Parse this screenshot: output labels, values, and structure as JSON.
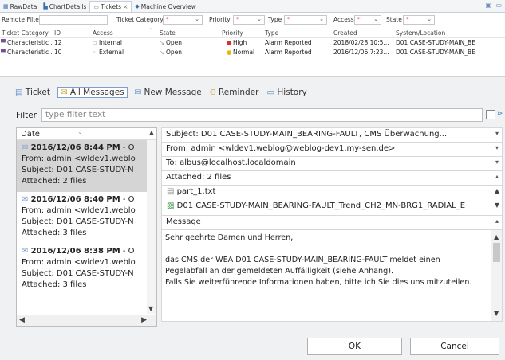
{
  "tabs": [
    {
      "label": "RawData",
      "icon": "table-icon"
    },
    {
      "label": "ChartDetails",
      "icon": "chart-icon"
    },
    {
      "label": "Tickets",
      "icon": "tickets-icon",
      "close": "×",
      "active": true
    },
    {
      "label": "Machine Overview",
      "icon": "machine-icon"
    }
  ],
  "filters": {
    "remote_filter_label": "Remote Filter",
    "ticket_category_label": "Ticket Category",
    "priority_label": "Priority",
    "type_label": "Type",
    "access_label": "Access",
    "state_label": "State",
    "dropdown_glyph": "*"
  },
  "table": {
    "columns": [
      "Ticket Category",
      "ID",
      "Access",
      "State",
      "Priority",
      "Type",
      "Created",
      "System/Location"
    ],
    "rows": [
      {
        "category": "Characteristic ...",
        "id": "12",
        "access": "Internal",
        "state": "Open",
        "priority": "High",
        "type": "Alarm Reported",
        "created": "2018/02/28 10:5...",
        "location": "D01 CASE-STUDY-MAIN_BE"
      },
      {
        "category": "Characteristic ...",
        "id": "10",
        "access": "External",
        "state": "Open",
        "priority": "Normal",
        "type": "Alarm Reported",
        "created": "2016/12/06 7:23...",
        "location": "D01 CASE-STUDY-MAIN_BE"
      }
    ]
  },
  "subtabs": [
    {
      "label": "Ticket",
      "icon": "ticket-icon"
    },
    {
      "label": "All Messages",
      "icon": "messages-icon",
      "active": true
    },
    {
      "label": "New Message",
      "icon": "new-message-icon"
    },
    {
      "label": "Reminder",
      "icon": "reminder-icon"
    },
    {
      "label": "History",
      "icon": "history-icon"
    }
  ],
  "filter": {
    "label": "Filter",
    "placeholder": "type filter text"
  },
  "messages": {
    "date_header": "Date",
    "items": [
      {
        "date": "2016/12/06 8:44 PM",
        "suffix": " - O",
        "from": "From: admin <wldev1.weblo",
        "subject": "Subject: D01 CASE-STUDY-N",
        "attached": "Attached: 2 files",
        "selected": true
      },
      {
        "date": "2016/12/06 8:40 PM",
        "suffix": " - O",
        "from": "From: admin <wldev1.weblo",
        "subject": "Subject: D01 CASE-STUDY-N",
        "attached": "Attached: 3 files",
        "selected": false
      },
      {
        "date": "2016/12/06 8:38 PM",
        "suffix": " - O",
        "from": "From: admin <wldev1.weblo",
        "subject": "Subject: D01 CASE-STUDY-N",
        "attached": "Attached: 3 files",
        "selected": false
      }
    ]
  },
  "detail": {
    "subject": "Subject: D01 CASE-STUDY-MAIN_BEARING-FAULT, CMS Überwachung...",
    "from": "From: admin <wldev1.weblog@weblog-dev1.my-sen.de>",
    "to": "To: albus@localhost.localdomain",
    "attached": "Attached: 2 files",
    "files": [
      "part_1.txt",
      "D01 CASE-STUDY-MAIN_BEARING-FAULT_Trend_CH2_MN-BRG1_RADIAL_E"
    ],
    "message_label": "Message",
    "message_lines": [
      "Sehr geehrte Damen und Herren,",
      "",
      "das CMS der WEA D01 CASE-STUDY-MAIN_BEARING-FAULT meldet einen",
      "Pegelabfall an der gemeldeten Auffälligkeit (siehe Anhang).",
      "Falls Sie weiterführende Informationen haben, bitte ich Sie dies uns mitzuteilen."
    ]
  },
  "buttons": {
    "ok": "OK",
    "cancel": "Cancel"
  },
  "colors": {
    "high": "#d9302c",
    "normal": "#e6b800",
    "accent": "#5a86c4"
  }
}
